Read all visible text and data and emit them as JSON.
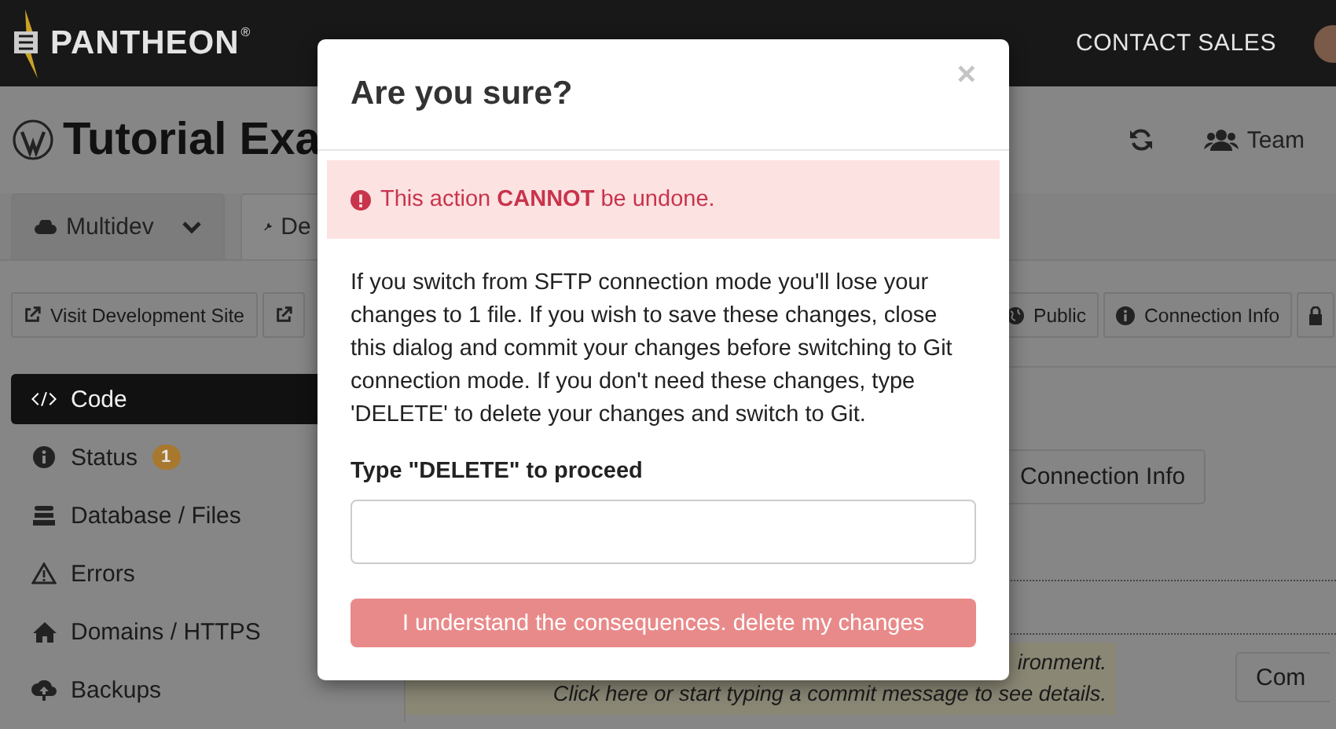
{
  "topbar": {
    "logo": "PANTHEON",
    "logo_mark": "®",
    "nav": [
      "CONTACT SALES"
    ]
  },
  "site": {
    "title": "Tutorial Exa",
    "team": "Team"
  },
  "tabs": [
    {
      "label": "Multidev",
      "selected": false,
      "kind": "dropdown"
    },
    {
      "label": "De",
      "selected": true,
      "kind": "plain"
    }
  ],
  "toolbar": [
    {
      "kind": "text",
      "label": "Visit Development Site"
    },
    {
      "kind": "icon"
    },
    {
      "kind": "text",
      "label": "Public"
    },
    {
      "kind": "text",
      "label": "Connection Info"
    },
    {
      "kind": "icon"
    }
  ],
  "sidebar": {
    "items": [
      {
        "label": "Code",
        "selected": true
      },
      {
        "label": "Status",
        "selected": false,
        "badge": "1"
      },
      {
        "label": "Database / Files",
        "selected": false
      },
      {
        "label": "Errors",
        "selected": false
      },
      {
        "label": "Domains / HTTPS",
        "selected": false
      },
      {
        "label": "Backups",
        "selected": false
      }
    ]
  },
  "content": {
    "connection_button": "Connection Info",
    "commit_notice": [
      "ironment.",
      "Click here or start typing a commit message to see details."
    ],
    "commit_button": "Com"
  },
  "modal": {
    "title": "Are you sure?",
    "close": "×",
    "alert": "This action **CANNOT** be undone.",
    "body": "If you switch from SFTP connection mode you'll lose your changes to 1 file. If you wish to save these changes, close this dialog and commit your changes before switching to Git connection mode. If you don't need these changes, type 'DELETE' to delete your changes and switch to Git.",
    "field_label": "Type \"DELETE\" to proceed",
    "button": {
      "label": "I understand the consequences. delete my changes",
      "disabled": true
    }
  }
}
